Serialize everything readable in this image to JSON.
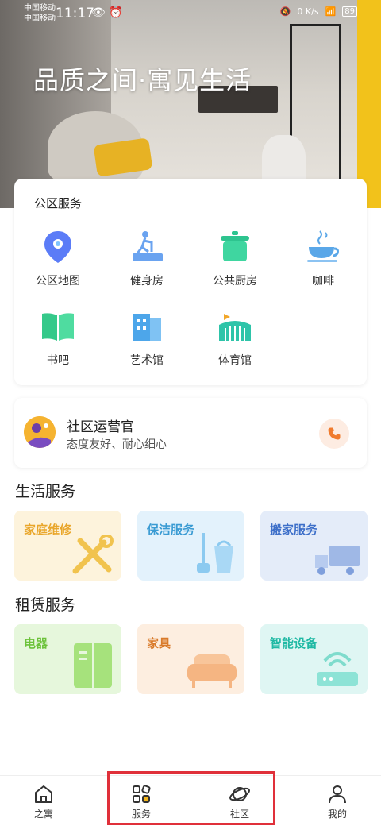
{
  "status_bar": {
    "carrier_1": "中国移动",
    "carrier_2": "中国移动",
    "time": "11:17",
    "speed": "0 K/s",
    "battery": "89"
  },
  "hero": {
    "title": "品质之间·寓见生活"
  },
  "public_services": {
    "title": "公区服务",
    "items": [
      {
        "label": "公区地图",
        "icon": "map-pin-icon"
      },
      {
        "label": "健身房",
        "icon": "treadmill-icon"
      },
      {
        "label": "公共厨房",
        "icon": "cooking-pot-icon"
      },
      {
        "label": "咖啡",
        "icon": "coffee-cup-icon"
      },
      {
        "label": "书吧",
        "icon": "book-icon"
      },
      {
        "label": "艺术馆",
        "icon": "gallery-building-icon"
      },
      {
        "label": "体育馆",
        "icon": "stadium-icon"
      }
    ]
  },
  "operator": {
    "title": "社区运营官",
    "subtitle": "态度友好、耐心细心"
  },
  "life_services": {
    "title": "生活服务",
    "tiles": [
      {
        "label": "家庭维修",
        "color": "#e9a62a",
        "icon": "tools-icon"
      },
      {
        "label": "保洁服务",
        "color": "#3a9bd3",
        "icon": "mop-bucket-icon"
      },
      {
        "label": "搬家服务",
        "color": "#3d6fc9",
        "icon": "truck-icon"
      }
    ]
  },
  "rental_services": {
    "title": "租赁服务",
    "tiles": [
      {
        "label": "电器",
        "color": "#6cc23a",
        "icon": "fridge-icon"
      },
      {
        "label": "家具",
        "color": "#d97a2a",
        "icon": "sofa-icon"
      },
      {
        "label": "智能设备",
        "color": "#1fb9a4",
        "icon": "wifi-router-icon"
      }
    ]
  },
  "tabbar": {
    "tabs": [
      {
        "label": "之寓",
        "icon": "home-icon"
      },
      {
        "label": "服务",
        "icon": "grid-icon"
      },
      {
        "label": "社区",
        "icon": "planet-icon"
      },
      {
        "label": "我的",
        "icon": "person-icon"
      }
    ]
  }
}
